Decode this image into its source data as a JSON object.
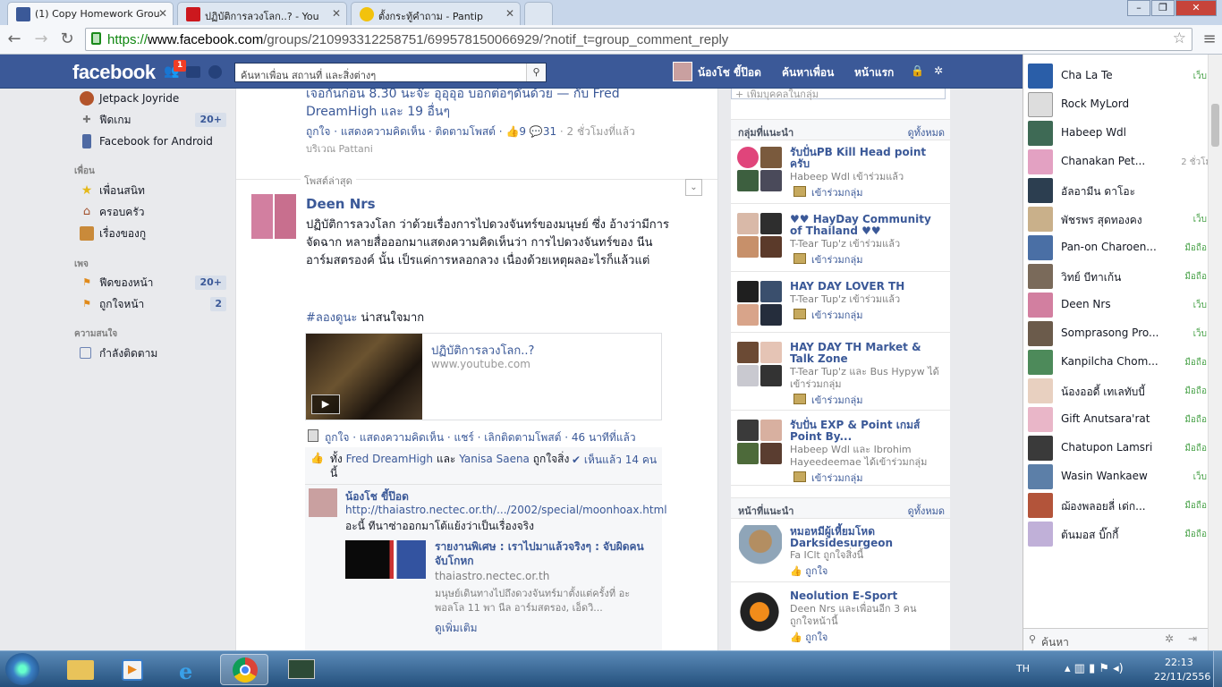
{
  "browser": {
    "tabs": [
      {
        "title": "(1) Copy Homework Grou",
        "icon": "facebook-icon",
        "color": "#3b5998"
      },
      {
        "title": "ปฏิบัติการลวงโลก..? - You",
        "icon": "youtube-icon",
        "color": "#cc181e"
      },
      {
        "title": "ตั้งกระทู้คำถาม - Pantip",
        "icon": "pantip-icon",
        "color": "#f2c20d"
      }
    ],
    "url_scheme": "https://",
    "url_host": "www.facebook.com",
    "url_path": "/groups/210993312258751/699578150066929/?notif_t=group_comment_reply"
  },
  "fb": {
    "logo": "facebook",
    "notif_count": "1",
    "search_placeholder": "ค้นหาเพื่อน สถานที่ และสิ่งต่างๆ",
    "user_name": "น้องโช ขี้ป๊อด",
    "find_friends": "ค้นหาเพื่อน",
    "home": "หน้าแรก"
  },
  "leftnav": {
    "items_top": [
      {
        "label": "Jetpack Joyride",
        "icon": "jetpack-icon"
      },
      {
        "label": "ฟีดเกม",
        "count": "20+",
        "icon": "games-icon"
      },
      {
        "label": "Facebook for Android",
        "icon": "android-icon"
      }
    ],
    "friends_head": "เพื่อน",
    "friends": [
      {
        "label": "เพื่อนสนิท",
        "icon": "star-icon"
      },
      {
        "label": "ครอบครัว",
        "icon": "house-icon"
      },
      {
        "label": "เรื่องของกู",
        "icon": "list-icon"
      }
    ],
    "pages_head": "เพจ",
    "pages": [
      {
        "label": "ฟีดของหน้า",
        "count": "20+",
        "icon": "pages-feed-icon"
      },
      {
        "label": "ถูกใจหน้า",
        "count": "2",
        "icon": "like-pages-icon"
      }
    ],
    "interests_head": "ความสนใจ",
    "interests": [
      {
        "label": "กำลังติดตาม",
        "icon": "following-icon"
      }
    ]
  },
  "feed": {
    "prev_post_text": "เจอกันก่อน 8.30 นะจ๊ะ อุอุอุอ บอกต่อๆดันด้วย — กับ Fred DreamHigh และ 19 อื่นๆ",
    "prev_actions": "ถูกใจ · แสดงความคิดเห็น · ติดตามโพสต์ ·",
    "prev_likes": "9",
    "prev_comments": "31",
    "prev_time": "· 2 ชั่วโมงที่แล้ว",
    "prev_location": "บริเวณ Pattani",
    "recent_label": "โพสต์ล่าสุด",
    "author": "Deen Nrs",
    "body": "ปฏิบัติการลวงโลก ว่าด้วยเรื่องการไปดวงจันทร์ของมนุษย์ ซึ่ง อ้างว่ามีการจัดฉาก หลายสื่อออกมาแสดงความคิดเห็นว่า การไปดวงจันทร์ของ นีน อาร์มสตรองค์ นั้น เป็รแค่การหลอกลวง เนื่องด้วยเหตุผลอะไรก็แล้วแต่",
    "hashtag": "#ลองดูนะ",
    "hashtag_rest": " น่าสนใจมาก",
    "link_title": "ปฏิบัติการลวงโลก..?",
    "link_domain": "www.youtube.com",
    "actions": "ถูกใจ · แสดงความคิดเห็น · แชร์ · เลิกติดตามโพสต์ · 46 นาทีที่แล้ว",
    "likes_prefix": "ทั้ง ",
    "liker1": "Fred DreamHigh",
    "likes_and": " และ ",
    "liker2": "Yanisa Saena",
    "likes_suffix": " ถูกใจสิ่งนี้",
    "seen": "เห็นแล้ว 14 คน",
    "comment_author": "น้องโช ขี้ป๊อด",
    "comment_link": "http://thaiastro.nectec.or.th/.../2002/special/moonhoax.html",
    "comment_text": "อะนี้ ทีนาซ่าออกมาโต้แย้งว่าเป็นเรื่องจริง",
    "share_title": "รายงานพิเศษ : เราไปมาแล้วจริงๆ : จับผิดคนจับโกหก",
    "share_domain": "thaiastro.nectec.or.th",
    "share_desc": "มนุษย์เดินทางไปถึงดวงจันทร์มาตั้งแต่ครั้งที่ อะพอลโล 11 พา นีล อาร์มสตรอง, เอ็ดวิ...",
    "see_more": "ดูเพิ่มเติม"
  },
  "right": {
    "add_people": "+ เพิ่มบุคคลในกลุ่ม",
    "groups_head": "กลุ่มที่แนะนำ",
    "see_all": "ดูทั้งหมด",
    "join": "เข้าร่วมกลุ่ม",
    "groups": [
      {
        "name": "รับปั่นPB Kill Head point ครับ",
        "sub": "Habeep Wdl เข้าร่วมแล้ว"
      },
      {
        "name": "♥♥ HayDay Community of Thailand ♥♥",
        "sub": "T-Tear Tup'z เข้าร่วมแล้ว"
      },
      {
        "name": "HAY DAY LOVER TH",
        "sub": "T-Tear Tup'z เข้าร่วมแล้ว"
      },
      {
        "name": "HAY DAY TH Market & Talk Zone",
        "sub": "T-Tear Tup'z และ Bus Hypyw ได้เข้าร่วมกลุ่ม"
      },
      {
        "name": "รับปั่น EXP & Point เกมส์ Point By...",
        "sub": "Habeep Wdl และ Ibrohim Hayeedeemae ได้เข้าร่วมกลุ่ม"
      }
    ],
    "pages_head": "หน้าที่แนะนำ",
    "like": "ถูกใจ",
    "pages": [
      {
        "name": "หมอหมีผู้เหี้ยมโหด Darksidesurgeon",
        "sub": "Fa IClt ถูกใจสิ่งนี้"
      },
      {
        "name": "Neolution E-Sport",
        "sub": "Deen Nrs และเพื่อนอีก 3 คน ถูกใจหน้านี้"
      }
    ]
  },
  "chat": {
    "search": "ค้นหา",
    "friends": [
      {
        "name": "Cha La Te",
        "status": "เว็บ"
      },
      {
        "name": "Rock MyLord",
        "status": ""
      },
      {
        "name": "Habeep Wdl",
        "status": ""
      },
      {
        "name": "Chanakan Pet...",
        "status": "2 ชั่วโมง"
      },
      {
        "name": "อัลอามีน ดาโอะ",
        "status": ""
      },
      {
        "name": "พัชรพร สุดทองคง",
        "status": "เว็บ"
      },
      {
        "name": "Pan-on Charoen...",
        "status": "มือถือ"
      },
      {
        "name": "วิทย์ บีทาเก้น",
        "status": "มือถือ"
      },
      {
        "name": "Deen Nrs",
        "status": "เว็บ"
      },
      {
        "name": "Somprasong Pro...",
        "status": "เว็บ"
      },
      {
        "name": "Kanpilcha Chom...",
        "status": "มือถือ"
      },
      {
        "name": "น้องออดี้ เทเลทับบี้",
        "status": "มือถือ"
      },
      {
        "name": "Gift Anutsara'rat",
        "status": "มือถือ"
      },
      {
        "name": "Chatupon Lamsri",
        "status": "มือถือ"
      },
      {
        "name": "Wasin Wankaew",
        "status": "เว็บ"
      },
      {
        "name": "ฌ้องพลอยลี่ เด่ก...",
        "status": "มือถือ"
      },
      {
        "name": "ต้นมอส บิ๊กกี้",
        "status": "มือถือ"
      }
    ]
  },
  "taskbar": {
    "lang": "TH",
    "time": "22:13",
    "date": "22/11/2556"
  }
}
